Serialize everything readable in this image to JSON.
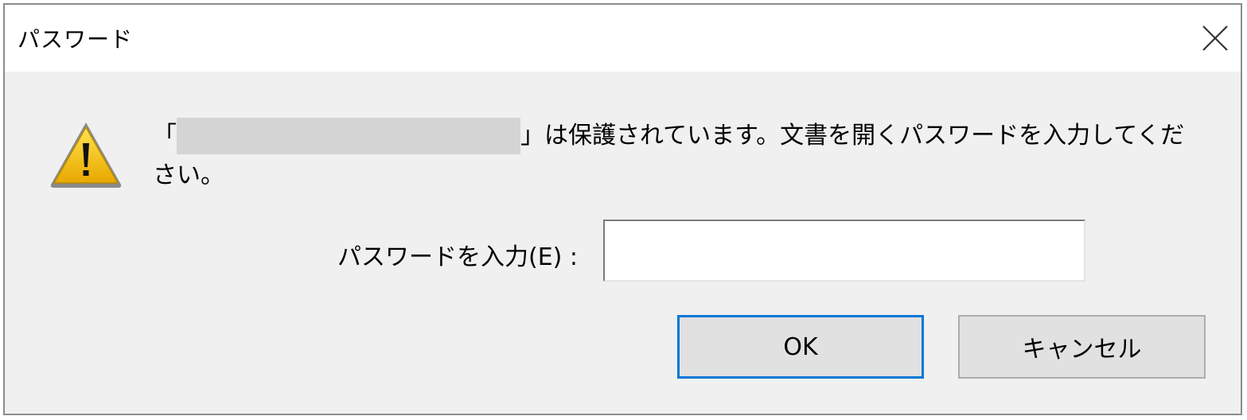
{
  "dialog": {
    "title": "パスワード",
    "message_open_bracket": "「",
    "message_rest": "」は保護されています。文書を開くパスワードを入力してください。",
    "password_label": "パスワードを入力(E) :",
    "password_value": "",
    "ok_label": "OK",
    "cancel_label": "キャンセル"
  },
  "icons": {
    "close": "close-icon",
    "warning": "warning-icon"
  },
  "colors": {
    "dialog_bg": "#f0f0f0",
    "titlebar_bg": "#ffffff",
    "focus_accent": "#0078d7",
    "warning_yellow": "#f5c400",
    "redaction_gray": "#d4d4d4"
  }
}
